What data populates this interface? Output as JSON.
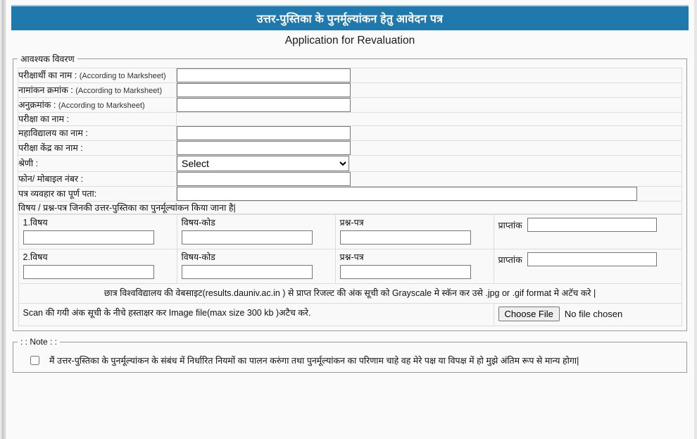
{
  "header": {
    "title_hi": "उत्तर-पुस्तिका के पुनर्मूल्यांकन हेतु आवेदन पत्र",
    "subtitle_en": "Application for Revaluation",
    "bar_color": "#1f79ad"
  },
  "fieldset": {
    "legend": "आवश्यक विवरण"
  },
  "fields": [
    {
      "label_hi": "परीक्षार्थी का नाम :",
      "label_en": "(According to Marksheet)",
      "type": "text",
      "value": "",
      "name": "candidate-name"
    },
    {
      "label_hi": "नामांकन क्रमांक :",
      "label_en": "(According to Marksheet)",
      "type": "text",
      "value": "",
      "name": "enrollment-number"
    },
    {
      "label_hi": "अनुक्रमांक :",
      "label_en": "(According to Marksheet)",
      "type": "text",
      "value": "",
      "name": "roll-number"
    },
    {
      "label_hi": "परीक्षा का नाम :",
      "label_en": "",
      "type": "none",
      "value": "",
      "name": "exam-name"
    },
    {
      "label_hi": "महाविद्यालय का नाम :",
      "label_en": "",
      "type": "text",
      "value": "",
      "name": "college-name"
    },
    {
      "label_hi": "परीक्षा केंद्र का नाम :",
      "label_en": "",
      "type": "text",
      "value": "",
      "name": "exam-center-name"
    },
    {
      "label_hi": "श्रेणी :",
      "label_en": "",
      "type": "select",
      "value": "Select",
      "options": [
        "Select"
      ],
      "name": "category"
    },
    {
      "label_hi": "फोन/ मोबाइल नंबर :",
      "label_en": "",
      "type": "text",
      "value": "",
      "name": "phone-number"
    },
    {
      "label_hi": "पत्र व्यवहार का पूर्ण पता:",
      "label_en": "",
      "type": "text-wide",
      "value": "",
      "name": "postal-address"
    }
  ],
  "subjects": {
    "heading": "विषय / प्रश्न-पत्र जिनकी उत्तर-पुस्तिका का पुनर्मूल्यांकन किया जाना है|",
    "rows": [
      {
        "subject_label": "1.विषय",
        "subject_code_label": "विषय-कोड",
        "paper_label": "प्रश्न-पत्र",
        "marks_label": "प्राप्तांक",
        "subject_value": "",
        "subject_code_value": "",
        "paper_value": "",
        "marks_value": ""
      },
      {
        "subject_label": "2.विषय",
        "subject_code_label": "विषय-कोड",
        "paper_label": "प्रश्न-पत्र",
        "marks_label": "प्राप्तांक",
        "subject_value": "",
        "subject_code_value": "",
        "paper_value": "",
        "marks_value": ""
      }
    ]
  },
  "instruction": {
    "text": "छात्र विश्वविद्यालय की वेबसाइट(results.dauniv.ac.in ) से प्राप्त रिजल्ट की अंक सूची को Grayscale मे स्कॅन कर उसे .jpg or .gif format  मे अटॅच करे |",
    "color": "#2222cc"
  },
  "upload": {
    "label": "Scan की गयी अंक सूची के नीचे हस्ताक्षर कर Image file(max size 300 kb )अटैच करे.",
    "button_label": "Choose File",
    "file_status": "No file chosen"
  },
  "note": {
    "legend": ": : Note : :",
    "declaration": "मैं उत्तर-पुस्तिका के पुनर्मूल्यांकन के संबंध में निर्धारित नियमों का पालन करुंगा तथा पुनर्मूल्यांकन का परिणाम चाहे वह मेरे पक्ष या विपक्ष में हो मुझे अंतिम रूप से मान्य होगा|",
    "checked": false
  }
}
